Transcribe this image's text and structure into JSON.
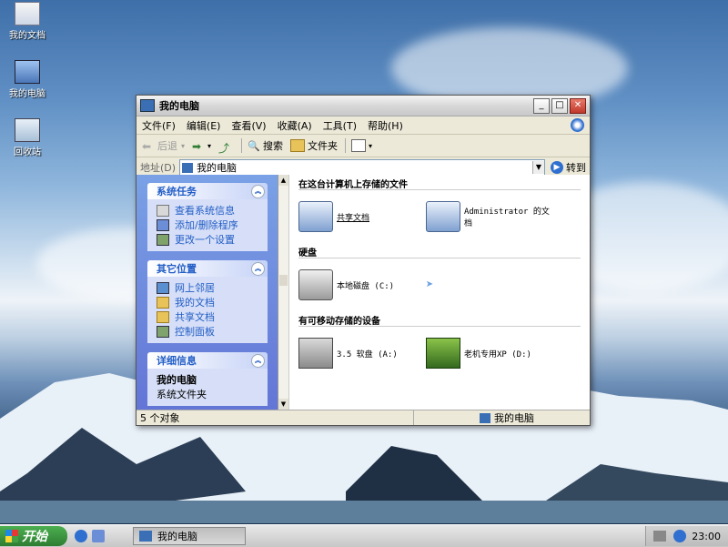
{
  "desktop": {
    "icons": [
      {
        "label": "我的文档"
      },
      {
        "label": "我的电脑"
      },
      {
        "label": "回收站"
      }
    ]
  },
  "window": {
    "title": "我的电脑",
    "menu": [
      "文件(F)",
      "编辑(E)",
      "查看(V)",
      "收藏(A)",
      "工具(T)",
      "帮助(H)"
    ],
    "toolbar": {
      "back": "后退",
      "search": "搜索",
      "folders": "文件夹"
    },
    "address": {
      "label": "地址(D)",
      "value": "我的电脑",
      "go": "转到"
    },
    "taskpane": {
      "system_tasks": {
        "title": "系统任务",
        "links": [
          "查看系统信息",
          "添加/删除程序",
          "更改一个设置"
        ]
      },
      "other_places": {
        "title": "其它位置",
        "links": [
          "网上邻居",
          "我的文档",
          "共享文档",
          "控制面板"
        ]
      },
      "details": {
        "title": "详细信息",
        "name": "我的电脑",
        "desc": "系统文件夹"
      }
    },
    "sections": {
      "files": {
        "title": "在这台计算机上存储的文件",
        "items": [
          "共享文档",
          "Administrator 的文档"
        ]
      },
      "hard_disks": {
        "title": "硬盘",
        "items": [
          "本地磁盘 (C:)"
        ]
      },
      "removable": {
        "title": "有可移动存储的设备",
        "items": [
          "3.5 软盘 (A:)",
          "老机专用XP (D:)"
        ]
      }
    },
    "status": {
      "count": "5 个对象",
      "location": "我的电脑"
    }
  },
  "taskbar": {
    "start": "开始",
    "task": "我的电脑",
    "clock": "23:00"
  },
  "colors": {
    "taskpane": "#6f8fe0",
    "link": "#215dc6",
    "start_button": "#3a9a3e"
  }
}
